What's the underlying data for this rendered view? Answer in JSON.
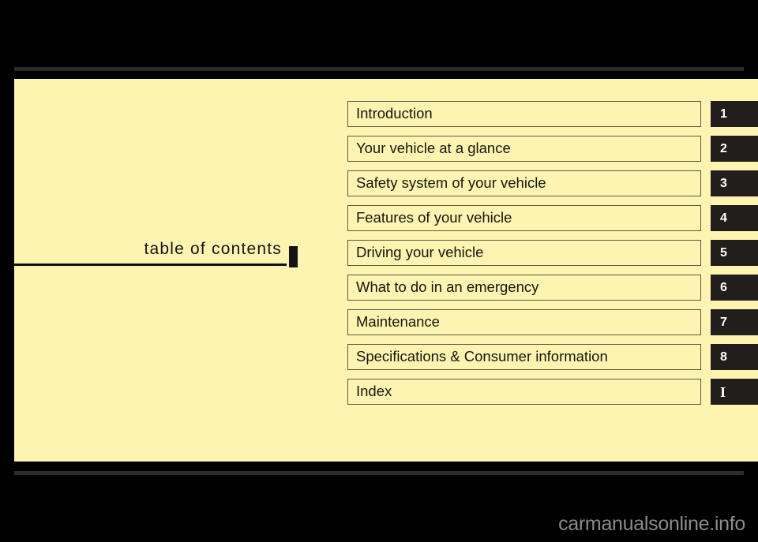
{
  "page": {
    "heading": "table of contents",
    "background_color": "#000000",
    "panel_color": "#fcf4b0",
    "tab_color": "#211e1c",
    "rule_color": "#2b2b2b"
  },
  "contents": {
    "items": [
      {
        "label": "Introduction",
        "tab": "1"
      },
      {
        "label": "Your vehicle at a glance",
        "tab": "2"
      },
      {
        "label": "Safety system of your vehicle",
        "tab": "3"
      },
      {
        "label": "Features of your vehicle",
        "tab": "4"
      },
      {
        "label": "Driving your vehicle",
        "tab": "5"
      },
      {
        "label": "What to do in an emergency",
        "tab": "6"
      },
      {
        "label": "Maintenance",
        "tab": "7"
      },
      {
        "label": "Specifications & Consumer information",
        "tab": "8"
      },
      {
        "label": "Index",
        "tab": "I"
      }
    ]
  },
  "watermark": {
    "text": "carmanualsonline.info"
  }
}
